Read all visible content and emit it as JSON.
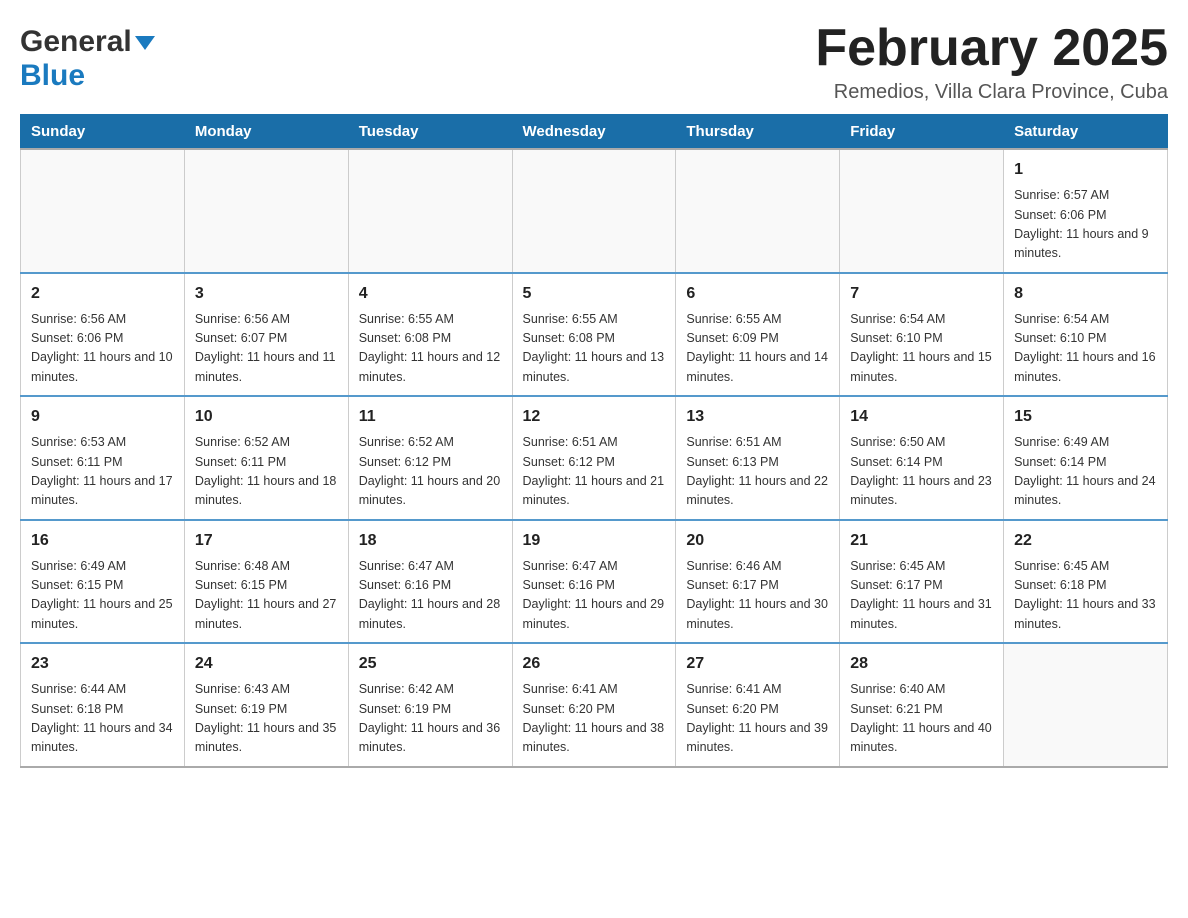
{
  "header": {
    "logo_general": "General",
    "logo_blue": "Blue",
    "title": "February 2025",
    "subtitle": "Remedios, Villa Clara Province, Cuba"
  },
  "days_of_week": [
    "Sunday",
    "Monday",
    "Tuesday",
    "Wednesday",
    "Thursday",
    "Friday",
    "Saturday"
  ],
  "weeks": [
    [
      {
        "day": "",
        "info": ""
      },
      {
        "day": "",
        "info": ""
      },
      {
        "day": "",
        "info": ""
      },
      {
        "day": "",
        "info": ""
      },
      {
        "day": "",
        "info": ""
      },
      {
        "day": "",
        "info": ""
      },
      {
        "day": "1",
        "info": "Sunrise: 6:57 AM\nSunset: 6:06 PM\nDaylight: 11 hours and 9 minutes."
      }
    ],
    [
      {
        "day": "2",
        "info": "Sunrise: 6:56 AM\nSunset: 6:06 PM\nDaylight: 11 hours and 10 minutes."
      },
      {
        "day": "3",
        "info": "Sunrise: 6:56 AM\nSunset: 6:07 PM\nDaylight: 11 hours and 11 minutes."
      },
      {
        "day": "4",
        "info": "Sunrise: 6:55 AM\nSunset: 6:08 PM\nDaylight: 11 hours and 12 minutes."
      },
      {
        "day": "5",
        "info": "Sunrise: 6:55 AM\nSunset: 6:08 PM\nDaylight: 11 hours and 13 minutes."
      },
      {
        "day": "6",
        "info": "Sunrise: 6:55 AM\nSunset: 6:09 PM\nDaylight: 11 hours and 14 minutes."
      },
      {
        "day": "7",
        "info": "Sunrise: 6:54 AM\nSunset: 6:10 PM\nDaylight: 11 hours and 15 minutes."
      },
      {
        "day": "8",
        "info": "Sunrise: 6:54 AM\nSunset: 6:10 PM\nDaylight: 11 hours and 16 minutes."
      }
    ],
    [
      {
        "day": "9",
        "info": "Sunrise: 6:53 AM\nSunset: 6:11 PM\nDaylight: 11 hours and 17 minutes."
      },
      {
        "day": "10",
        "info": "Sunrise: 6:52 AM\nSunset: 6:11 PM\nDaylight: 11 hours and 18 minutes."
      },
      {
        "day": "11",
        "info": "Sunrise: 6:52 AM\nSunset: 6:12 PM\nDaylight: 11 hours and 20 minutes."
      },
      {
        "day": "12",
        "info": "Sunrise: 6:51 AM\nSunset: 6:12 PM\nDaylight: 11 hours and 21 minutes."
      },
      {
        "day": "13",
        "info": "Sunrise: 6:51 AM\nSunset: 6:13 PM\nDaylight: 11 hours and 22 minutes."
      },
      {
        "day": "14",
        "info": "Sunrise: 6:50 AM\nSunset: 6:14 PM\nDaylight: 11 hours and 23 minutes."
      },
      {
        "day": "15",
        "info": "Sunrise: 6:49 AM\nSunset: 6:14 PM\nDaylight: 11 hours and 24 minutes."
      }
    ],
    [
      {
        "day": "16",
        "info": "Sunrise: 6:49 AM\nSunset: 6:15 PM\nDaylight: 11 hours and 25 minutes."
      },
      {
        "day": "17",
        "info": "Sunrise: 6:48 AM\nSunset: 6:15 PM\nDaylight: 11 hours and 27 minutes."
      },
      {
        "day": "18",
        "info": "Sunrise: 6:47 AM\nSunset: 6:16 PM\nDaylight: 11 hours and 28 minutes."
      },
      {
        "day": "19",
        "info": "Sunrise: 6:47 AM\nSunset: 6:16 PM\nDaylight: 11 hours and 29 minutes."
      },
      {
        "day": "20",
        "info": "Sunrise: 6:46 AM\nSunset: 6:17 PM\nDaylight: 11 hours and 30 minutes."
      },
      {
        "day": "21",
        "info": "Sunrise: 6:45 AM\nSunset: 6:17 PM\nDaylight: 11 hours and 31 minutes."
      },
      {
        "day": "22",
        "info": "Sunrise: 6:45 AM\nSunset: 6:18 PM\nDaylight: 11 hours and 33 minutes."
      }
    ],
    [
      {
        "day": "23",
        "info": "Sunrise: 6:44 AM\nSunset: 6:18 PM\nDaylight: 11 hours and 34 minutes."
      },
      {
        "day": "24",
        "info": "Sunrise: 6:43 AM\nSunset: 6:19 PM\nDaylight: 11 hours and 35 minutes."
      },
      {
        "day": "25",
        "info": "Sunrise: 6:42 AM\nSunset: 6:19 PM\nDaylight: 11 hours and 36 minutes."
      },
      {
        "day": "26",
        "info": "Sunrise: 6:41 AM\nSunset: 6:20 PM\nDaylight: 11 hours and 38 minutes."
      },
      {
        "day": "27",
        "info": "Sunrise: 6:41 AM\nSunset: 6:20 PM\nDaylight: 11 hours and 39 minutes."
      },
      {
        "day": "28",
        "info": "Sunrise: 6:40 AM\nSunset: 6:21 PM\nDaylight: 11 hours and 40 minutes."
      },
      {
        "day": "",
        "info": ""
      }
    ]
  ]
}
